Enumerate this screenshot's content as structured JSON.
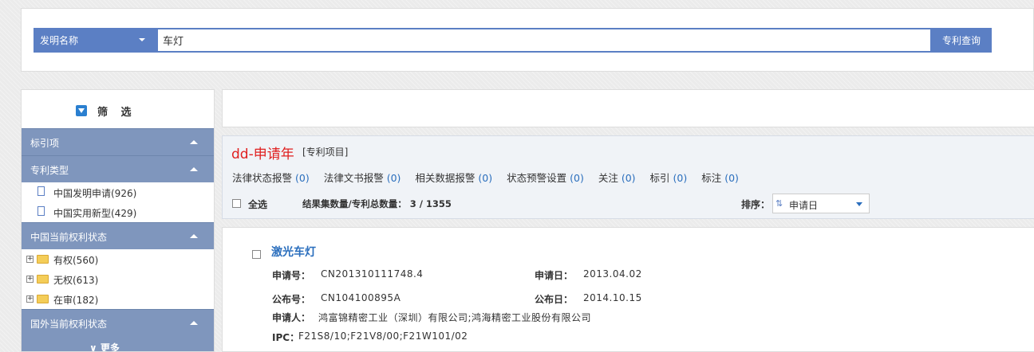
{
  "search": {
    "field": "发明名称",
    "value": "车灯",
    "button": "专利查询"
  },
  "sidebar": {
    "filter_title": "筛 选",
    "sections": [
      {
        "label": "标引项"
      },
      {
        "label": "专利类型",
        "items": [
          "中国发明申请(926)",
          "中国实用新型(429)"
        ]
      },
      {
        "label": "中国当前权利状态",
        "items": [
          "有权(560)",
          "无权(613)",
          "在审(182)"
        ]
      },
      {
        "label": "国外当前权利状态"
      }
    ],
    "more": "∨ 更多"
  },
  "project": {
    "title": "dd-申请年",
    "tag": "[专利项目]",
    "actions": [
      {
        "label": "法律状态报警",
        "count": "(0)"
      },
      {
        "label": "法律文书报警",
        "count": "(0)"
      },
      {
        "label": "相关数据报警",
        "count": "(0)"
      },
      {
        "label": "状态预警设置",
        "count": "(0)"
      },
      {
        "label": "关注",
        "count": "(0)"
      },
      {
        "label": "标引",
        "count": "(0)"
      },
      {
        "label": "标注",
        "count": "(0)"
      }
    ],
    "select_all": "全选",
    "result_count": "结果集数量/专利总数量： 3  /  1355",
    "sort_label": "排序：",
    "sort_value": "申请日"
  },
  "result": {
    "title": "激光车灯",
    "app_no_label": "申请号：",
    "app_no": "CN201310111748.4",
    "app_date_label": "申请日：",
    "app_date": "2013.04.02",
    "pub_no_label": "公布号：",
    "pub_no": "CN104100895A",
    "pub_date_label": "公布日：",
    "pub_date": "2014.10.15",
    "applicant_label": "申请人：",
    "applicant": "鸿富锦精密工业（深圳）有限公司;鸿海精密工业股份有限公司",
    "ipc_label": "IPC：",
    "ipc": "F21S8/10;F21V8/00;F21W101/02"
  },
  "colors": {
    "accent": "#5b7fc4",
    "section": "#7f96bd",
    "link": "#2a6ebd",
    "title_red": "#e02020"
  }
}
